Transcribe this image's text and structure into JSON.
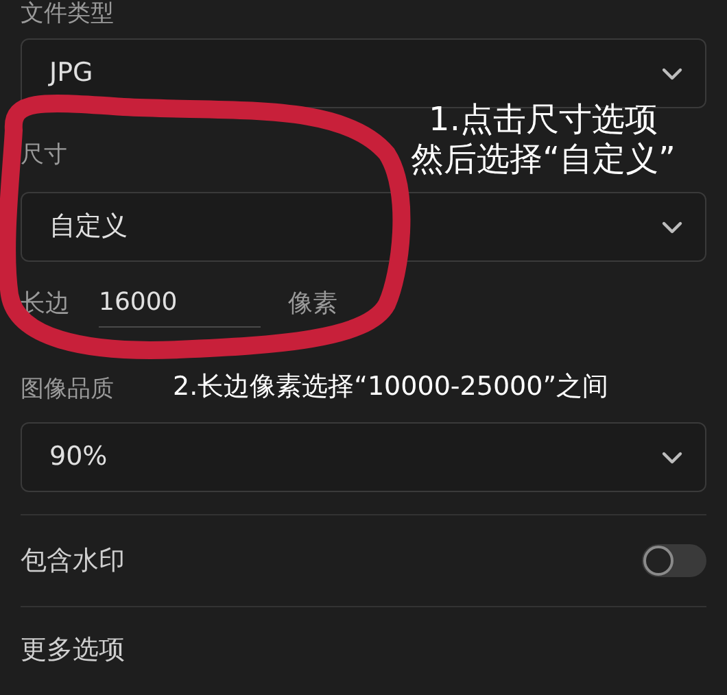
{
  "file_type": {
    "label": "文件类型",
    "value": "JPG"
  },
  "size": {
    "label": "尺寸",
    "value": "自定义",
    "long_edge": {
      "label": "长边",
      "value": "16000",
      "unit": "像素"
    }
  },
  "quality": {
    "label": "图像品质",
    "value": "90%"
  },
  "watermark": {
    "label": "包含水印",
    "on": false
  },
  "more_options": {
    "label": "更多选项"
  },
  "annotations": [
    {
      "lines": [
        "1.点击尺寸选项",
        "然后选择“自定义”"
      ]
    },
    {
      "lines": [
        "2.长边像素选择“10000-25000”之间"
      ]
    }
  ]
}
